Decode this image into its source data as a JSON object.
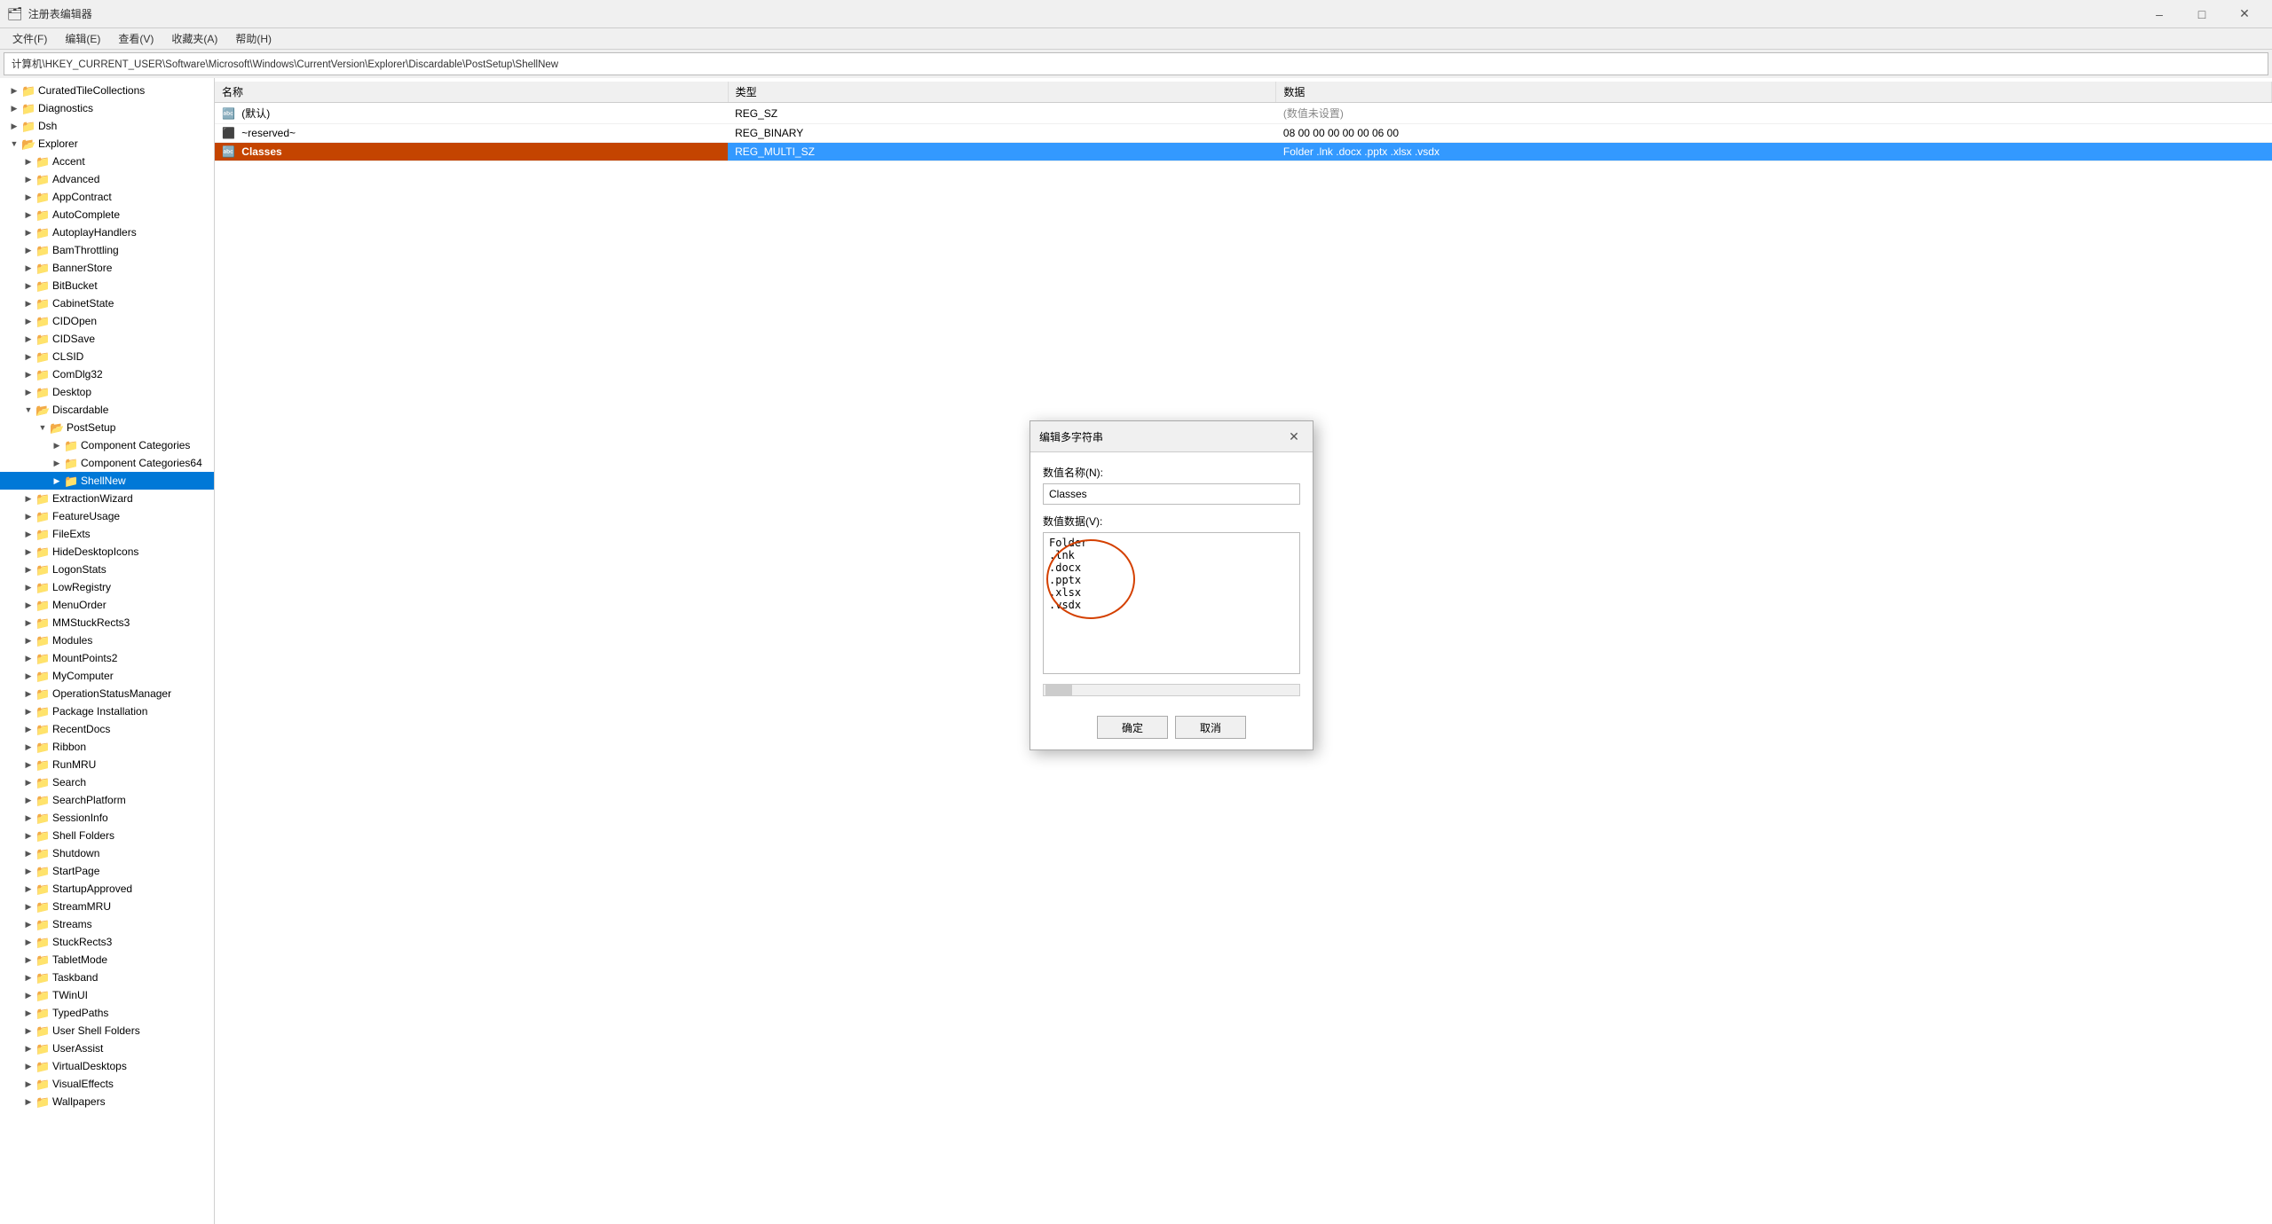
{
  "app": {
    "title": "注册表编辑器",
    "icon": "regedit"
  },
  "menu": {
    "items": [
      "文件(F)",
      "编辑(E)",
      "查看(V)",
      "收藏夹(A)",
      "帮助(H)"
    ]
  },
  "address_bar": {
    "label": "计算机\\HKEY_CURRENT_USER\\Software\\Microsoft\\Windows\\CurrentVersion\\Explorer\\Discardable\\PostSetup\\ShellNew"
  },
  "tree": {
    "items": [
      {
        "id": "curatedtile",
        "label": "CuratedTileCollections",
        "level": 2,
        "expanded": false,
        "selected": false
      },
      {
        "id": "diagnostics",
        "label": "Diagnostics",
        "level": 2,
        "expanded": false,
        "selected": false
      },
      {
        "id": "dsh",
        "label": "Dsh",
        "level": 2,
        "expanded": false,
        "selected": false
      },
      {
        "id": "explorer",
        "label": "Explorer",
        "level": 2,
        "expanded": true,
        "selected": false
      },
      {
        "id": "accent",
        "label": "Accent",
        "level": 3,
        "expanded": false,
        "selected": false
      },
      {
        "id": "advanced",
        "label": "Advanced",
        "level": 3,
        "expanded": false,
        "selected": false
      },
      {
        "id": "appcontract",
        "label": "AppContract",
        "level": 3,
        "expanded": false,
        "selected": false
      },
      {
        "id": "autocomplete",
        "label": "AutoComplete",
        "level": 3,
        "expanded": false,
        "selected": false
      },
      {
        "id": "autoplayhandlers",
        "label": "AutoplayHandlers",
        "level": 3,
        "expanded": false,
        "selected": false
      },
      {
        "id": "bamthrottling",
        "label": "BamThrottling",
        "level": 3,
        "expanded": false,
        "selected": false
      },
      {
        "id": "bannerstore",
        "label": "BannerStore",
        "level": 3,
        "expanded": false,
        "selected": false
      },
      {
        "id": "bitbucket",
        "label": "BitBucket",
        "level": 3,
        "expanded": false,
        "selected": false
      },
      {
        "id": "cabinetstate",
        "label": "CabinetState",
        "level": 3,
        "expanded": false,
        "selected": false
      },
      {
        "id": "cidopen",
        "label": "CIDOpen",
        "level": 3,
        "expanded": false,
        "selected": false
      },
      {
        "id": "cidsave",
        "label": "CIDSave",
        "level": 3,
        "expanded": false,
        "selected": false
      },
      {
        "id": "clsid",
        "label": "CLSID",
        "level": 3,
        "expanded": false,
        "selected": false
      },
      {
        "id": "comdlg32",
        "label": "ComDlg32",
        "level": 3,
        "expanded": false,
        "selected": false
      },
      {
        "id": "desktop",
        "label": "Desktop",
        "level": 3,
        "expanded": false,
        "selected": false
      },
      {
        "id": "discardable",
        "label": "Discardable",
        "level": 3,
        "expanded": true,
        "selected": false
      },
      {
        "id": "postsetup",
        "label": "PostSetup",
        "level": 4,
        "expanded": true,
        "selected": false
      },
      {
        "id": "component_categories",
        "label": "Component Categories",
        "level": 5,
        "expanded": false,
        "selected": false
      },
      {
        "id": "component_categories64",
        "label": "Component Categories64",
        "level": 5,
        "expanded": false,
        "selected": false
      },
      {
        "id": "shellnew",
        "label": "ShellNew",
        "level": 5,
        "expanded": false,
        "selected": true
      },
      {
        "id": "extractionwizard",
        "label": "ExtractionWizard",
        "level": 3,
        "expanded": false,
        "selected": false
      },
      {
        "id": "featureusage",
        "label": "FeatureUsage",
        "level": 3,
        "expanded": false,
        "selected": false
      },
      {
        "id": "fileexts",
        "label": "FileExts",
        "level": 3,
        "expanded": false,
        "selected": false
      },
      {
        "id": "hidedesktopicons",
        "label": "HideDesktopIcons",
        "level": 3,
        "expanded": false,
        "selected": false
      },
      {
        "id": "logonstats",
        "label": "LogonStats",
        "level": 3,
        "expanded": false,
        "selected": false
      },
      {
        "id": "lowregistry",
        "label": "LowRegistry",
        "level": 3,
        "expanded": false,
        "selected": false
      },
      {
        "id": "menuorder",
        "label": "MenuOrder",
        "level": 3,
        "expanded": false,
        "selected": false
      },
      {
        "id": "mmstuckrects3",
        "label": "MMStuckRects3",
        "level": 3,
        "expanded": false,
        "selected": false
      },
      {
        "id": "modules",
        "label": "Modules",
        "level": 3,
        "expanded": false,
        "selected": false
      },
      {
        "id": "mountpoints2",
        "label": "MountPoints2",
        "level": 3,
        "expanded": false,
        "selected": false
      },
      {
        "id": "mycomputer",
        "label": "MyComputer",
        "level": 3,
        "expanded": false,
        "selected": false
      },
      {
        "id": "operationstatusmanager",
        "label": "OperationStatusManager",
        "level": 3,
        "expanded": false,
        "selected": false
      },
      {
        "id": "packageinstallation",
        "label": "Package Installation",
        "level": 3,
        "expanded": false,
        "selected": false
      },
      {
        "id": "recentdocs",
        "label": "RecentDocs",
        "level": 3,
        "expanded": false,
        "selected": false
      },
      {
        "id": "ribbon",
        "label": "Ribbon",
        "level": 3,
        "expanded": false,
        "selected": false
      },
      {
        "id": "runmru",
        "label": "RunMRU",
        "level": 3,
        "expanded": false,
        "selected": false
      },
      {
        "id": "search",
        "label": "Search",
        "level": 3,
        "expanded": false,
        "selected": false
      },
      {
        "id": "searchplatform",
        "label": "SearchPlatform",
        "level": 3,
        "expanded": false,
        "selected": false
      },
      {
        "id": "sessioninfo",
        "label": "SessionInfo",
        "level": 3,
        "expanded": false,
        "selected": false
      },
      {
        "id": "shellfolders",
        "label": "Shell Folders",
        "level": 3,
        "expanded": false,
        "selected": false
      },
      {
        "id": "shutdown",
        "label": "Shutdown",
        "level": 3,
        "expanded": false,
        "selected": false
      },
      {
        "id": "startpage",
        "label": "StartPage",
        "level": 3,
        "expanded": false,
        "selected": false
      },
      {
        "id": "startupapproved",
        "label": "StartupApproved",
        "level": 3,
        "expanded": false,
        "selected": false
      },
      {
        "id": "streammru",
        "label": "StreamMRU",
        "level": 3,
        "expanded": false,
        "selected": false
      },
      {
        "id": "streams",
        "label": "Streams",
        "level": 3,
        "expanded": false,
        "selected": false
      },
      {
        "id": "stuckrects3",
        "label": "StuckRects3",
        "level": 3,
        "expanded": false,
        "selected": false
      },
      {
        "id": "tabletmode",
        "label": "TabletMode",
        "level": 3,
        "expanded": false,
        "selected": false
      },
      {
        "id": "taskband",
        "label": "Taskband",
        "level": 3,
        "expanded": false,
        "selected": false
      },
      {
        "id": "twinui",
        "label": "TWinUI",
        "level": 3,
        "expanded": false,
        "selected": false
      },
      {
        "id": "typedpaths",
        "label": "TypedPaths",
        "level": 3,
        "expanded": false,
        "selected": false
      },
      {
        "id": "usershellfolders",
        "label": "User Shell Folders",
        "level": 3,
        "expanded": false,
        "selected": false
      },
      {
        "id": "userassist",
        "label": "UserAssist",
        "level": 3,
        "expanded": false,
        "selected": false
      },
      {
        "id": "virtualdesktops",
        "label": "VirtualDesktops",
        "level": 3,
        "expanded": false,
        "selected": false
      },
      {
        "id": "visualeffects",
        "label": "VisualEffects",
        "level": 3,
        "expanded": false,
        "selected": false
      },
      {
        "id": "wallpapers",
        "label": "Wallpapers",
        "level": 3,
        "expanded": false,
        "selected": false
      }
    ]
  },
  "registry_table": {
    "columns": [
      "名称",
      "类型",
      "数据"
    ],
    "rows": [
      {
        "name": "(默认)",
        "type": "REG_SZ",
        "data": "(数值未设置)",
        "icon": "default"
      },
      {
        "name": "~reserved~",
        "type": "REG_BINARY",
        "data": "08 00 00 00 00 00 06 00",
        "icon": "binary",
        "selected": false
      },
      {
        "name": "Classes",
        "type": "REG_MULTI_SZ",
        "data": "Folder .lnk .docx .pptx .xlsx .vsdx",
        "icon": "multistring",
        "selected": true
      }
    ]
  },
  "dialog": {
    "title": "编辑多字符串",
    "field_name_label": "数值名称(N):",
    "field_name_value": "Classes",
    "field_data_label": "数值数据(V):",
    "textarea_content": "Folder\n.lnk\n.docx\n.pptx\n.xlsx\n.vsdx",
    "btn_ok": "确定",
    "btn_cancel": "取消"
  },
  "colors": {
    "selected_highlight": "#3399ff",
    "folder_yellow": "#e8a000",
    "accent_orange": "#cc4400",
    "tree_selected_bg": "#0078d7",
    "classes_highlight": "#ff6600"
  }
}
